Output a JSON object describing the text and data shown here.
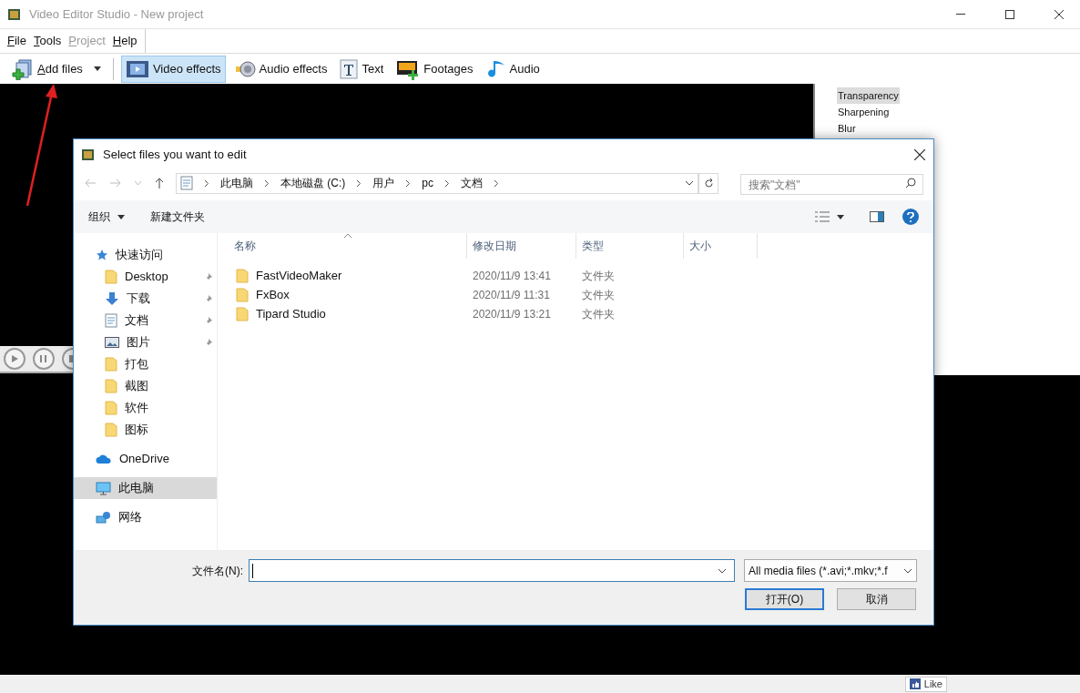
{
  "window": {
    "title": "Video Editor Studio - New project"
  },
  "menu": [
    {
      "label": "File",
      "disabled": false
    },
    {
      "label": "Tools",
      "disabled": false
    },
    {
      "label": "Project",
      "disabled": true
    },
    {
      "label": "Help",
      "disabled": false
    }
  ],
  "toolbar": [
    {
      "label": "Add files",
      "kind": "add",
      "selected": false,
      "dropdown": true
    },
    {
      "label": "Video effects",
      "kind": "video",
      "selected": true,
      "dropdown": false
    },
    {
      "label": "Audio effects",
      "kind": "speaker",
      "selected": false,
      "dropdown": false
    },
    {
      "label": "Text",
      "kind": "text",
      "selected": false,
      "dropdown": false
    },
    {
      "label": "Footages",
      "kind": "footage",
      "selected": false,
      "dropdown": false
    },
    {
      "label": "Audio",
      "kind": "note",
      "selected": false,
      "dropdown": false
    }
  ],
  "effects": [
    {
      "label": "Transparency",
      "selected": true
    },
    {
      "label": "Sharpening",
      "selected": false
    },
    {
      "label": "Blur",
      "selected": false
    }
  ],
  "status_bar": {
    "like": "Like"
  },
  "dialog": {
    "title": "Select files you want to edit",
    "breadcrumb": [
      "此电脑",
      "本地磁盘 (C:)",
      "用户",
      "pc",
      "文档"
    ],
    "search": {
      "placeholder": "搜索\"文档\""
    },
    "commands": [
      {
        "label": "组织",
        "dropdown": true
      },
      {
        "label": "新建文件夹",
        "dropdown": false
      }
    ],
    "nav": [
      {
        "label": "快速访问",
        "kind": "star",
        "selected": false,
        "children": [
          {
            "label": "Desktop",
            "kind": "folder",
            "pinned": true,
            "selected": false
          },
          {
            "label": "下载",
            "kind": "download",
            "pinned": true,
            "selected": false
          },
          {
            "label": "文档",
            "kind": "document",
            "pinned": true,
            "selected": false
          },
          {
            "label": "图片",
            "kind": "picture",
            "pinned": true,
            "selected": false
          },
          {
            "label": "打包",
            "kind": "folder",
            "pinned": false,
            "selected": false
          },
          {
            "label": "截图",
            "kind": "folder",
            "pinned": false,
            "selected": false
          },
          {
            "label": "软件",
            "kind": "folder",
            "pinned": false,
            "selected": false
          },
          {
            "label": "图标",
            "kind": "folder",
            "pinned": false,
            "selected": false
          }
        ]
      },
      {
        "label": "OneDrive",
        "kind": "cloud",
        "selected": false
      },
      {
        "label": "此电脑",
        "kind": "pc",
        "selected": true
      },
      {
        "label": "网络",
        "kind": "network",
        "selected": false
      }
    ],
    "columns": [
      "名称",
      "修改日期",
      "类型",
      "大小"
    ],
    "rows": [
      {
        "name": "FastVideoMaker",
        "modified": "2020/11/9 13:41",
        "type": "文件夹"
      },
      {
        "name": "FxBox",
        "modified": "2020/11/9 11:31",
        "type": "文件夹"
      },
      {
        "name": "Tipard Studio",
        "modified": "2020/11/9 13:21",
        "type": "文件夹"
      }
    ],
    "filename": {
      "label": "文件名(N):"
    },
    "filter": "All media files (*.avi;*.mkv;*.f",
    "buttons": [
      {
        "label": "打开(O)",
        "primary": true
      },
      {
        "label": "取消",
        "primary": false
      }
    ]
  }
}
